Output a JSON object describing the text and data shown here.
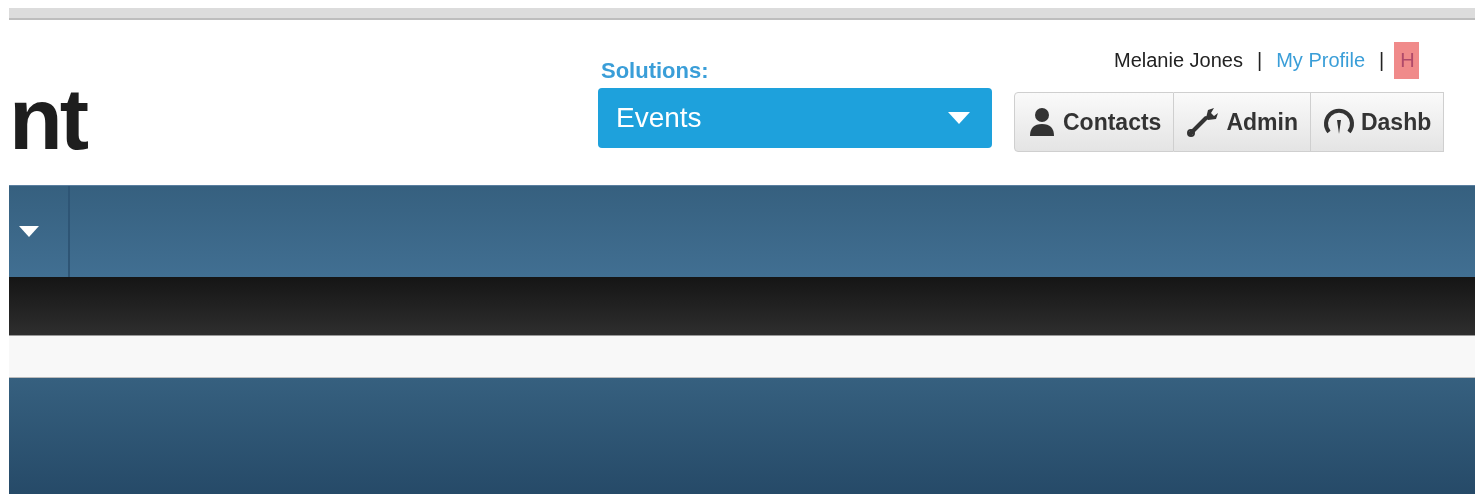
{
  "logo": {
    "text": "nt"
  },
  "user_menu": [
    {
      "kind": "name",
      "label": "Melanie Jones"
    },
    {
      "kind": "separator",
      "label": "|"
    },
    {
      "kind": "link",
      "label": "My Profile"
    },
    {
      "kind": "separator",
      "label": "|"
    },
    {
      "kind": "highlight",
      "label": "H"
    }
  ],
  "solutions": {
    "label": "Solutions:",
    "value": "Events"
  },
  "toolbar": [
    {
      "label": "Contacts"
    },
    {
      "label": "Admin"
    },
    {
      "label": "Dashb"
    }
  ]
}
